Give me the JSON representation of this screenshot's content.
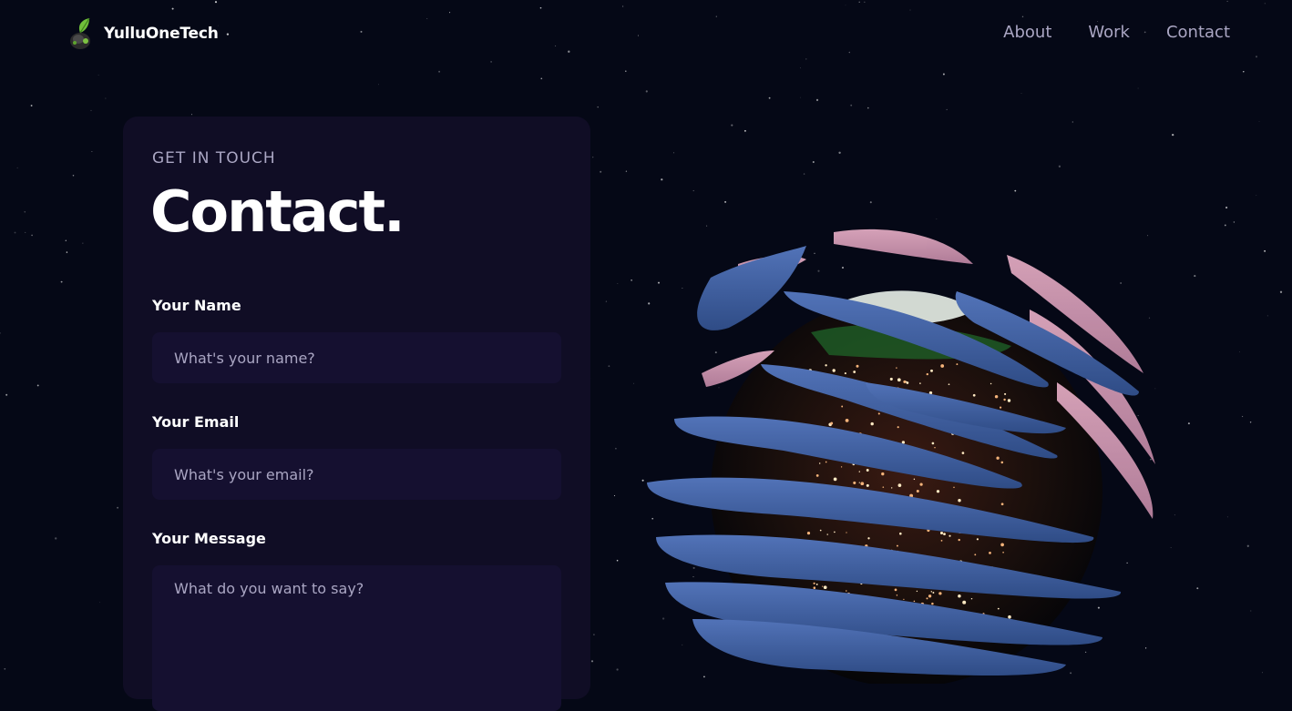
{
  "nav": {
    "brand": "YulluOneTech",
    "links": [
      "About",
      "Work",
      "Contact"
    ]
  },
  "contact": {
    "subtitle": "GET IN TOUCH",
    "title": "Contact.",
    "name_label": "Your Name",
    "name_placeholder": "What's your name?",
    "email_label": "Your Email",
    "email_placeholder": "What's your email?",
    "message_label": "Your Message",
    "message_placeholder": "What do you want to say?"
  },
  "colors": {
    "background": "#050816",
    "card": "#100d25",
    "input": "#151030",
    "secondary_text": "#aaa6c3",
    "ribbon_blue": "#3e5d9c",
    "ribbon_pink": "#d19bb4"
  }
}
